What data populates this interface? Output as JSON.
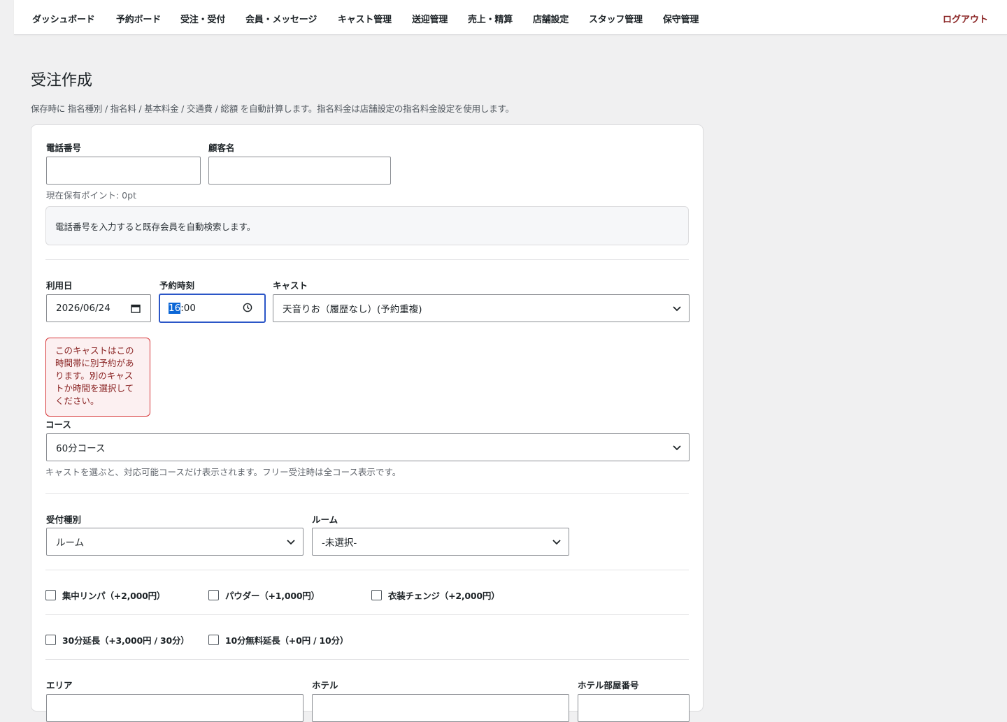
{
  "nav": {
    "items": [
      "ダッシュボード",
      "予約ボード",
      "受注・受付",
      "会員・メッセージ",
      "キャスト管理",
      "送迎管理",
      "売上・精算",
      "店舗設定",
      "スタッフ管理",
      "保守管理"
    ],
    "logout": "ログアウト"
  },
  "page": {
    "title": "受注作成",
    "description": "保存時に 指名種別 / 指名料 / 基本料金 / 交通費 / 総額 を自動計算します。指名料金は店舗設定の指名料金設定を使用します。"
  },
  "form": {
    "phone": {
      "label": "電話番号",
      "value": ""
    },
    "customer_name": {
      "label": "顧客名",
      "value": ""
    },
    "points_text": "現在保有ポイント: 0pt",
    "info_text": "電話番号を入力すると既存会員を自動検索します。",
    "date": {
      "label": "利用日",
      "value": "2026/06/24"
    },
    "time": {
      "label": "予約時刻",
      "hour": "16",
      "rest": ":00"
    },
    "cast": {
      "label": "キャスト",
      "value": "天音りお（履歴なし）(予約重複)"
    },
    "error": "このキャストはこの時間帯に別予約があります。別のキャストか時間を選択してください。",
    "course": {
      "label": "コース",
      "value": "60分コース",
      "hint": "キャストを選ぶと、対応可能コースだけ表示されます。フリー受注時は全コース表示です。"
    },
    "reception_type": {
      "label": "受付種別",
      "value": "ルーム"
    },
    "room": {
      "label": "ルーム",
      "value": "-未選択-"
    },
    "options_row1": [
      "集中リンパ（+2,000円）",
      "パウダー（+1,000円）",
      "衣装チェンジ（+2,000円）"
    ],
    "options_row2": [
      "30分延長（+3,000円 / 30分）",
      "10分無料延長（+0円 / 10分）"
    ],
    "area": {
      "label": "エリア"
    },
    "hotel": {
      "label": "ホテル"
    },
    "hotel_room": {
      "label": "ホテル部屋番号"
    }
  },
  "colors": {
    "focus": "#2b56c7",
    "error_border": "#d63638",
    "error_text": "#8a2424",
    "logout": "#8a2424"
  }
}
